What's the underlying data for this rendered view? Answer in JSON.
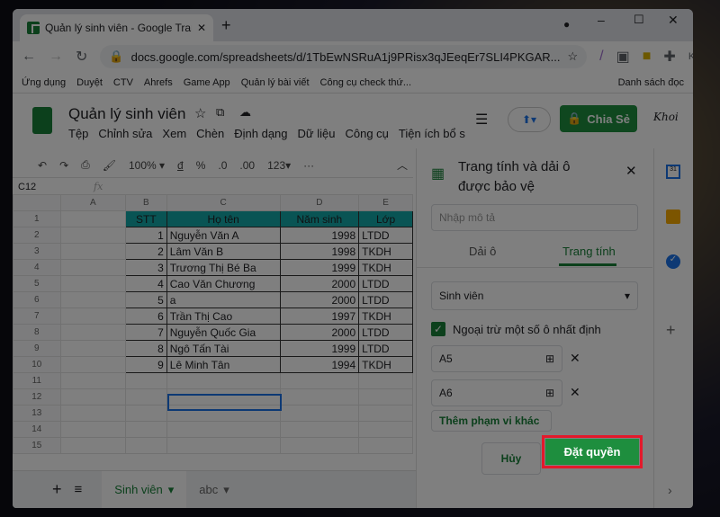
{
  "browser": {
    "tab_title": "Quản lý sinh viên - Google Trang",
    "url": "docs.google.com/spreadsheets/d/1TbEwNSRuA1j9PRisx3qJEeqEr7SLI4PKGAR...",
    "bookmarks": [
      "Ứng dụng",
      "Duyệt",
      "CTV",
      "Ahrefs",
      "Game App",
      "Quản lý bài viết",
      "Công cụ check thứ...",
      "Danh sách đọc"
    ]
  },
  "doc": {
    "title": "Quản lý sinh viên",
    "menu": [
      "Tệp",
      "Chỉnh sửa",
      "Xem",
      "Chèn",
      "Định dạng",
      "Dữ liệu",
      "Công cụ",
      "Tiện ích bổ s"
    ],
    "share": "Chia Sẻ",
    "avatar": "Khoi"
  },
  "toolbar": {
    "zoom": "100%",
    "currency": "đ",
    "percent": "%",
    "dec_less": ".0",
    "dec_more": ".00",
    "format": "123▾",
    "more": "···"
  },
  "cell_ref": "C12",
  "fx": "fx",
  "grid": {
    "columns": [
      "A",
      "B",
      "C",
      "D",
      "E"
    ],
    "header": [
      "STT",
      "Họ tên",
      "Năm sinh",
      "Lớp"
    ],
    "rows": [
      [
        "1",
        "Nguyễn Văn A",
        "1998",
        "LTDD"
      ],
      [
        "2",
        "Lâm Văn B",
        "1998",
        "TKDH"
      ],
      [
        "3",
        "Trương Thị Bé Ba",
        "1999",
        "TKDH"
      ],
      [
        "4",
        "Cao Văn Chương",
        "2000",
        "LTDD"
      ],
      [
        "5",
        "a",
        "2000",
        "LTDD"
      ],
      [
        "6",
        "Trần Thị Cao",
        "1997",
        "TKDH"
      ],
      [
        "7",
        "Nguyễn Quốc Gia",
        "2000",
        "LTDD"
      ],
      [
        "8",
        "Ngô Tấn Tài",
        "1999",
        "LTDD"
      ],
      [
        "9",
        "Lê Minh Tân",
        "1994",
        "TKDH"
      ]
    ],
    "row_numbers": [
      "1",
      "2",
      "3",
      "4",
      "5",
      "6",
      "7",
      "8",
      "9",
      "10",
      "11",
      "12",
      "13",
      "14",
      "15"
    ]
  },
  "sheets": [
    {
      "label": "Sinh viên",
      "active": true
    },
    {
      "label": "abc",
      "active": false
    }
  ],
  "panel": {
    "title": "Trang tính và dải ô được bảo vệ",
    "desc_placeholder": "Nhập mô tả",
    "tabs": [
      "Dải ô",
      "Trang tính"
    ],
    "sheet_select": "Sinh viên",
    "except_label": "Ngoại trừ một số ô nhất định",
    "except_checked": true,
    "ranges": [
      "A5",
      "A6"
    ],
    "add_range": "Thêm phạm vi khác",
    "cancel": "Hủy",
    "set": "Đặt quyền"
  },
  "colors": {
    "accent": "#1e8e3e",
    "header_fill": "#12a8a8",
    "highlight": "#e3192b"
  }
}
